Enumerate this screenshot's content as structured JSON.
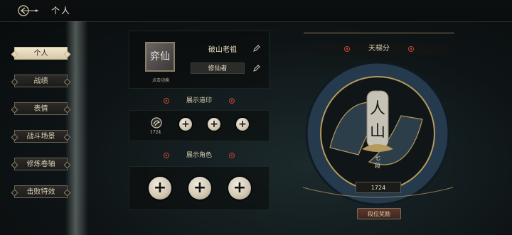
{
  "header": {
    "title": "个人",
    "back_icon": "back-arrow-icon"
  },
  "sidebar": {
    "items": [
      {
        "label": "个人",
        "active": true
      },
      {
        "label": "战绩",
        "active": false
      },
      {
        "label": "表情",
        "active": false
      },
      {
        "label": "战斗场景",
        "active": false
      },
      {
        "label": "修炼卷轴",
        "active": false
      },
      {
        "label": "击败特效",
        "active": false
      }
    ]
  },
  "profile": {
    "avatar_text": "弈仙",
    "avatar_caption": "点击切换",
    "name": "破山老祖",
    "title": "修仙者"
  },
  "seals": {
    "header": "展示道印",
    "items": [
      {
        "icon": "seal-icon",
        "value": "1724"
      }
    ],
    "empty_slots": 3
  },
  "roles": {
    "header": "展示角色",
    "empty_slots": 3
  },
  "ladder": {
    "header": "天梯分",
    "rank_text_top": "人",
    "rank_text_bottom": "山",
    "rank_tier_1": "七",
    "rank_tier_2": "段",
    "score": "1724",
    "button_label": "段位奖励"
  },
  "colors": {
    "accent_gold": "#c9b98a",
    "ornament_red": "#c4462e",
    "medallion_blue": "#2e4a62"
  }
}
